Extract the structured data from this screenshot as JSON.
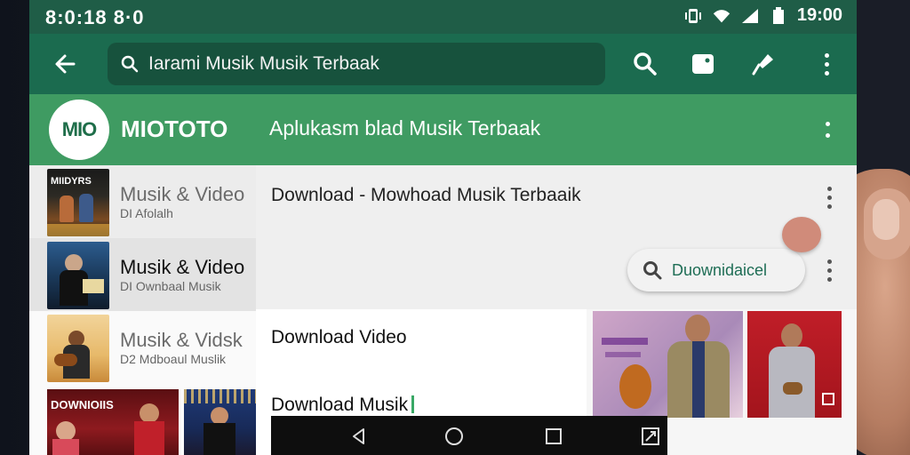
{
  "status_bar": {
    "time_left": "8:0:18 8·0",
    "time_right": "19:00",
    "icons": [
      "vibrate-icon",
      "wifi-icon",
      "signal-icon",
      "battery-icon"
    ]
  },
  "app_bar": {
    "back_icon": "back-arrow-icon",
    "search_text": "Iarami Musik Musik Terbaak",
    "actions": [
      "search-icon",
      "folder-icon",
      "mic-icon",
      "more-vert-icon"
    ]
  },
  "brand": {
    "logo_text": "MIO",
    "name": "MIOTOTO",
    "tagline": "Aplukasm blad Musik Terbaak"
  },
  "sidebar": {
    "items": [
      {
        "title": "Musik & Video",
        "subtitle": "DI Afolalh",
        "thumb_text": "MIIDYRS"
      },
      {
        "title": "Musik & Video",
        "subtitle": "DI Ownbaal Musik",
        "thumb_text": ""
      },
      {
        "title": "Musik & Vidsk",
        "subtitle": "D2 Mdboaul Muslik",
        "thumb_text": ""
      },
      {
        "thumb_text": "DOWNIOIIS"
      }
    ]
  },
  "content": {
    "title": "Download - Mowhoad Musik Terbaaik",
    "download_chip": "Duownidaicel",
    "download_video": "Download Video",
    "download_music": "Download Musik"
  },
  "colors": {
    "status_bar": "#1f5d47",
    "app_bar": "#1b6b4f",
    "brand_bar": "#3f9b62",
    "accent": "#1e6d55"
  },
  "nav": {
    "icons": [
      "back-triangle-icon",
      "home-circle-icon",
      "recents-square-icon",
      "screenshot-icon"
    ]
  }
}
